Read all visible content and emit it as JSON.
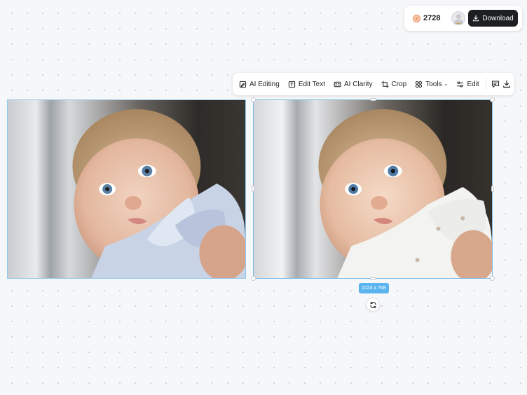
{
  "header": {
    "credits": "2728",
    "pro_label": "Pro",
    "download_label": "Download"
  },
  "toolbar": {
    "ai_editing": "AI Editing",
    "edit_text": "Edit Text",
    "ai_clarity": "AI Clarity",
    "crop": "Crop",
    "tools": "Tools",
    "edit": "Edit"
  },
  "canvas": {
    "size_label": "1024 x 768"
  },
  "icons": {
    "credits": "coin-icon",
    "avatar": "user-avatar",
    "download": "download-icon",
    "ai_editing": "ai-edit-icon",
    "edit_text": "text-icon",
    "ai_clarity": "clarity-icon",
    "crop": "crop-icon",
    "tools": "grid-icon",
    "edit": "sliders-icon",
    "comment": "comment-icon",
    "rotate": "rotate-icon"
  },
  "colors": {
    "selection": "#79b9ea",
    "size_badge": "#5bb4ee",
    "download_button": "#1e1f22"
  }
}
